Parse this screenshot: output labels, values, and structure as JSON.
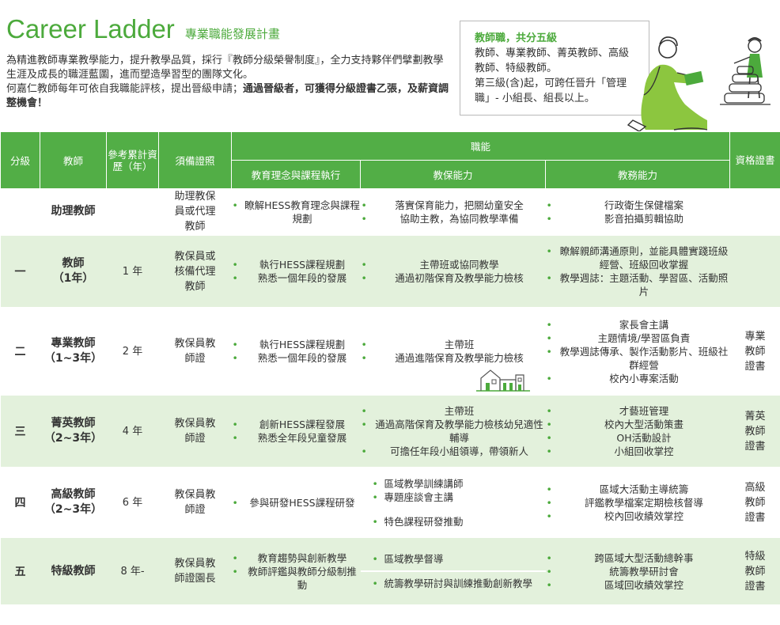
{
  "header": {
    "title_en": "Career Ladder",
    "title_zh": "專業職能發展計畫",
    "intro_1": "為精進教師專業教學能力，提升教學品質，採行『教師分級榮譽制度』，全力支持夥伴們擘劃教學生涯及成長的職涯藍圖，進而塑造學習型的團隊文化。",
    "intro_2a": "何嘉仁教師每年可依自我職能評核，提出晉級申請；",
    "intro_2b": "通過晉級者，可獲得分級證書乙張，及薪資調整機會！"
  },
  "infobox": {
    "title": "教師職，共分五級",
    "line1": "教師、專業教師、菁英教師、高級教師、特級教師。",
    "line2": "第三級(含)起，可跨任晉升「管理職」- 小組長、組長以上。"
  },
  "table": {
    "headers": {
      "grade": "分級",
      "teacher": "教師",
      "years": "參考累計資歷（年）",
      "license": "須備證照",
      "competency": "職能",
      "edu": "教育理念與課程執行",
      "care": "教保能力",
      "affairs": "教務能力",
      "cert": "資格證書"
    },
    "rows": [
      {
        "grade": "",
        "role": "助理教師",
        "role_sub": "",
        "years": "",
        "license": "助理教保員或代理教師",
        "edu": [
          "瞭解HESS教育理念與課程規劃"
        ],
        "care": [
          "落實保育能力，把關幼童安全",
          "協助主教，為協同教學準備"
        ],
        "care_extra": [],
        "affairs": [
          "行政衛生保健檔案",
          "影音拍攝剪輯協助"
        ],
        "cert": ""
      },
      {
        "grade": "一",
        "role": "教師",
        "role_sub": "（1年）",
        "years": "1 年",
        "license": "教保員或核備代理教師",
        "edu": [
          "執行HESS課程規劃",
          "熟悉一個年段的發展"
        ],
        "care": [
          "主帶班或協同教學",
          "通過初階保育及教學能力檢核"
        ],
        "care_extra": [],
        "affairs": [
          "瞭解親師溝通原則，並能具體實踐班級經營、班級回收掌握",
          "教學週誌：主題活動、學習區、活動照片"
        ],
        "cert": ""
      },
      {
        "grade": "二",
        "role": "專業教師",
        "role_sub": "（1~3年）",
        "years": "2 年",
        "license": "教保員教師證",
        "edu": [
          "執行HESS課程規劃",
          "熟悉一個年段的發展"
        ],
        "care": [
          "主帶班",
          "通過進階保育及教學能力檢核"
        ],
        "care_extra": [],
        "affairs": [
          "家長會主講",
          "主題情境/學習區負責",
          "教學週誌傳承、製作活動影片、班級社群經營",
          "校內小專案活動"
        ],
        "cert": "專業教師證書"
      },
      {
        "grade": "三",
        "role": "菁英教師",
        "role_sub": "（2~3年）",
        "years": "4 年",
        "license": "教保員教師證",
        "edu": [
          "創新HESS課程發展",
          "熟悉全年段兒童發展"
        ],
        "care": [
          "主帶班",
          "通過高階保育及教學能力檢核幼兒適性輔導",
          "可擔任年段小組領導，帶領新人"
        ],
        "care_extra": [],
        "affairs": [
          "才藝班管理",
          "校內大型活動策畫",
          "OH活動設計",
          "小組回收掌控"
        ],
        "cert": "菁英教師證書"
      },
      {
        "grade": "四",
        "role": "高級教師",
        "role_sub": "（2~3年）",
        "years": "6 年",
        "license": "教保員教師證",
        "edu": [
          "參與研發HESS課程研發"
        ],
        "care": [
          "區域教學訓練講師",
          "專題座談會主講"
        ],
        "care_extra": [
          "特色課程研發推動"
        ],
        "affairs": [
          "區域大活動主導統籌",
          "評鑑教學檔案定期檢核督導",
          "校內回收績效掌控"
        ],
        "cert": "高級教師證書"
      },
      {
        "grade": "五",
        "role": "特級教師",
        "role_sub": "",
        "years": "8 年-",
        "license": "教保員教師證園長",
        "edu": [
          "教育趨勢與創新教學",
          "教師評鑑與教師分級制推動"
        ],
        "care": [
          "區域教學督導"
        ],
        "care_extra": [
          "統籌教學研討與訓練推動創新教學"
        ],
        "affairs": [
          "跨區域大型活動總幹事",
          "統籌教學研討會",
          "區域回收績效掌控"
        ],
        "cert": "特級教師證書"
      }
    ]
  }
}
